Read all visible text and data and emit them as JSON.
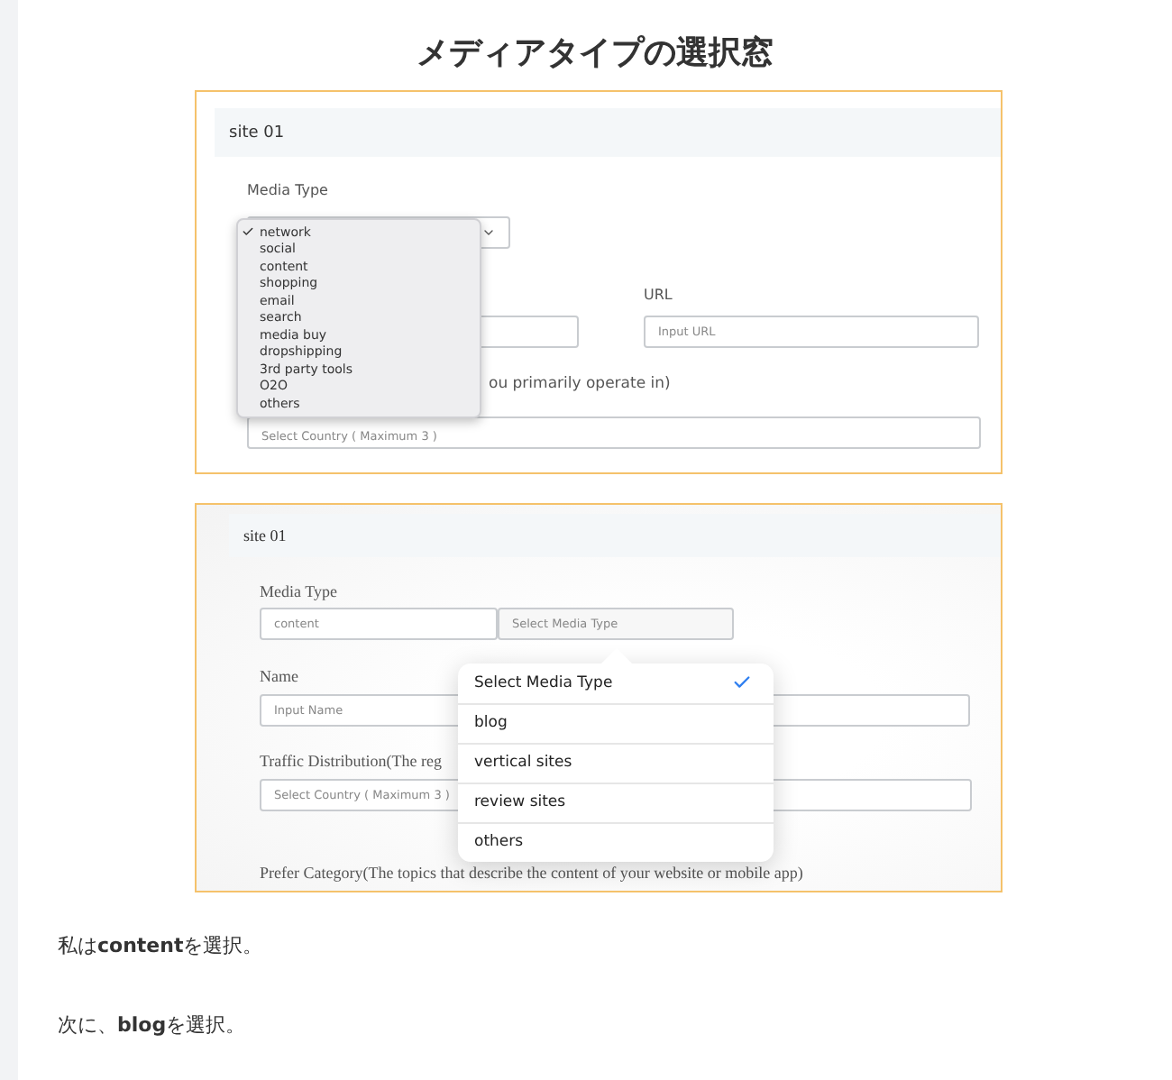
{
  "heading": "メディアタイプの選択窓",
  "screenshot_1": {
    "site": "site 01",
    "media_type_label": "Media Type",
    "menu": [
      {
        "label": "network",
        "selected": true
      },
      {
        "label": "social",
        "selected": false
      },
      {
        "label": "content",
        "selected": false
      },
      {
        "label": "shopping",
        "selected": false
      },
      {
        "label": "email",
        "selected": false
      },
      {
        "label": "search",
        "selected": false
      },
      {
        "label": "media buy",
        "selected": false
      },
      {
        "label": "dropshipping",
        "selected": false
      },
      {
        "label": "3rd party tools",
        "selected": false
      },
      {
        "label": "O2O",
        "selected": false
      },
      {
        "label": "others",
        "selected": false
      }
    ],
    "url_label": "URL",
    "url_placeholder": "Input URL",
    "region_label": "ou primarily operate in)",
    "country_placeholder": "Select Country ( Maximum 3 )"
  },
  "screenshot_2": {
    "site": "site 01",
    "media_type_label": "Media Type",
    "media_value": "content",
    "media_placeholder": "Select Media Type",
    "menu": [
      {
        "label": "Select Media Type",
        "selected": true
      },
      {
        "label": "blog",
        "selected": false
      },
      {
        "label": "vertical sites",
        "selected": false
      },
      {
        "label": "review sites",
        "selected": false
      },
      {
        "label": "others",
        "selected": false
      }
    ],
    "name_label": "Name",
    "name_placeholder": "Input Name",
    "traffic_label": "Traffic Distribution(The reg",
    "country_placeholder": "Select Country ( Maximum 3 )",
    "category_label": "Prefer Category(The topics that describe the content of your website or mobile app)"
  },
  "paragraphs": [
    "私は**content**を選択。",
    "次に、**blog**を選択。"
  ]
}
